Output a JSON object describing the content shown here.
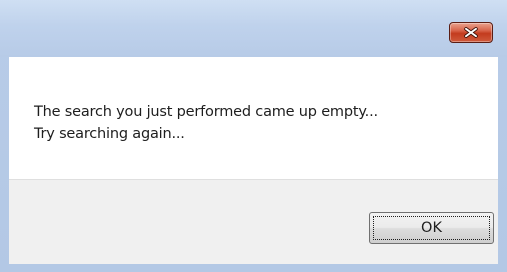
{
  "window": {
    "title": "",
    "frame_color": "#b9cde8",
    "close_button_color": "#c9462a"
  },
  "message": {
    "line1": "The search you just performed came up empty...",
    "line2": "Try searching again..."
  },
  "buttons": {
    "ok_label": "OK"
  },
  "icons": {
    "close": "close-x-icon"
  }
}
